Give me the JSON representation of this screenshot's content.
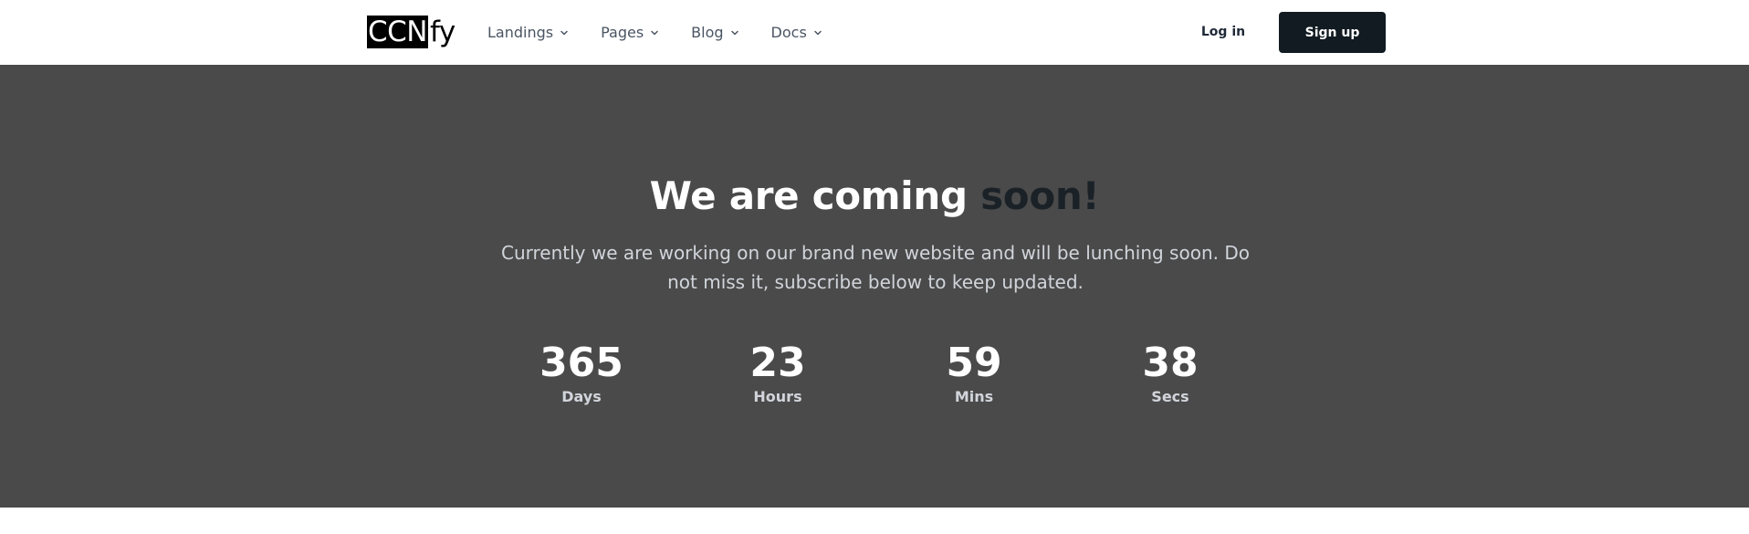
{
  "header": {
    "logo": {
      "boxed": "CCN",
      "rest": "fy"
    },
    "nav": [
      {
        "label": "Landings",
        "icon": "chevron-down-icon"
      },
      {
        "label": "Pages",
        "icon": "chevron-down-icon"
      },
      {
        "label": "Blog",
        "icon": "chevron-down-icon"
      },
      {
        "label": "Docs",
        "icon": "chevron-down-icon"
      }
    ],
    "login_label": "Log in",
    "signup_label": "Sign up"
  },
  "hero": {
    "title_main": "We are coming ",
    "title_accent": "soon!",
    "subtitle": "Currently we are working on our brand new website and will be lunching soon. Do not miss it, subscribe below to keep updated.",
    "countdown": [
      {
        "value": "365",
        "label": "Days"
      },
      {
        "value": "23",
        "label": "Hours"
      },
      {
        "value": "59",
        "label": "Mins"
      },
      {
        "value": "38",
        "label": "Secs"
      }
    ]
  },
  "colors": {
    "hero_background": "#4a4a4a",
    "accent_text": "#1a2228",
    "signup_background": "#111b21"
  }
}
